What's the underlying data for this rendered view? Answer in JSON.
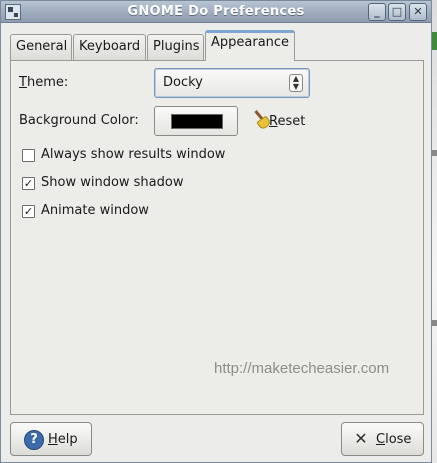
{
  "window": {
    "title": "GNOME Do Preferences",
    "controls": {
      "minimize": "_",
      "maximize": "□",
      "close": "✕"
    }
  },
  "tabs": [
    {
      "label": "General",
      "selected": false
    },
    {
      "label": "Keyboard",
      "selected": false
    },
    {
      "label": "Plugins",
      "selected": false
    },
    {
      "label": "Appearance",
      "selected": true
    }
  ],
  "appearance": {
    "theme_label_first": "T",
    "theme_label_rest": "heme:",
    "theme_value": "Docky",
    "background_color_label": "Background Color:",
    "background_color_value": "#000000",
    "reset_label_first": "R",
    "reset_label_rest": "eset",
    "options": [
      {
        "label": "Always show results window",
        "checked": false
      },
      {
        "label": "Show window shadow",
        "checked": true
      },
      {
        "label": "Animate window",
        "checked": true
      }
    ]
  },
  "watermark": "http://maketecheasier.com",
  "footer": {
    "help_label_first": "H",
    "help_label_rest": "elp",
    "close_label_first": "C",
    "close_label_rest": "lose"
  },
  "icons": {
    "app": "app-icon",
    "reset": "broom-icon",
    "help": "help-icon",
    "close": "close-icon",
    "check_glyph": "✓"
  }
}
